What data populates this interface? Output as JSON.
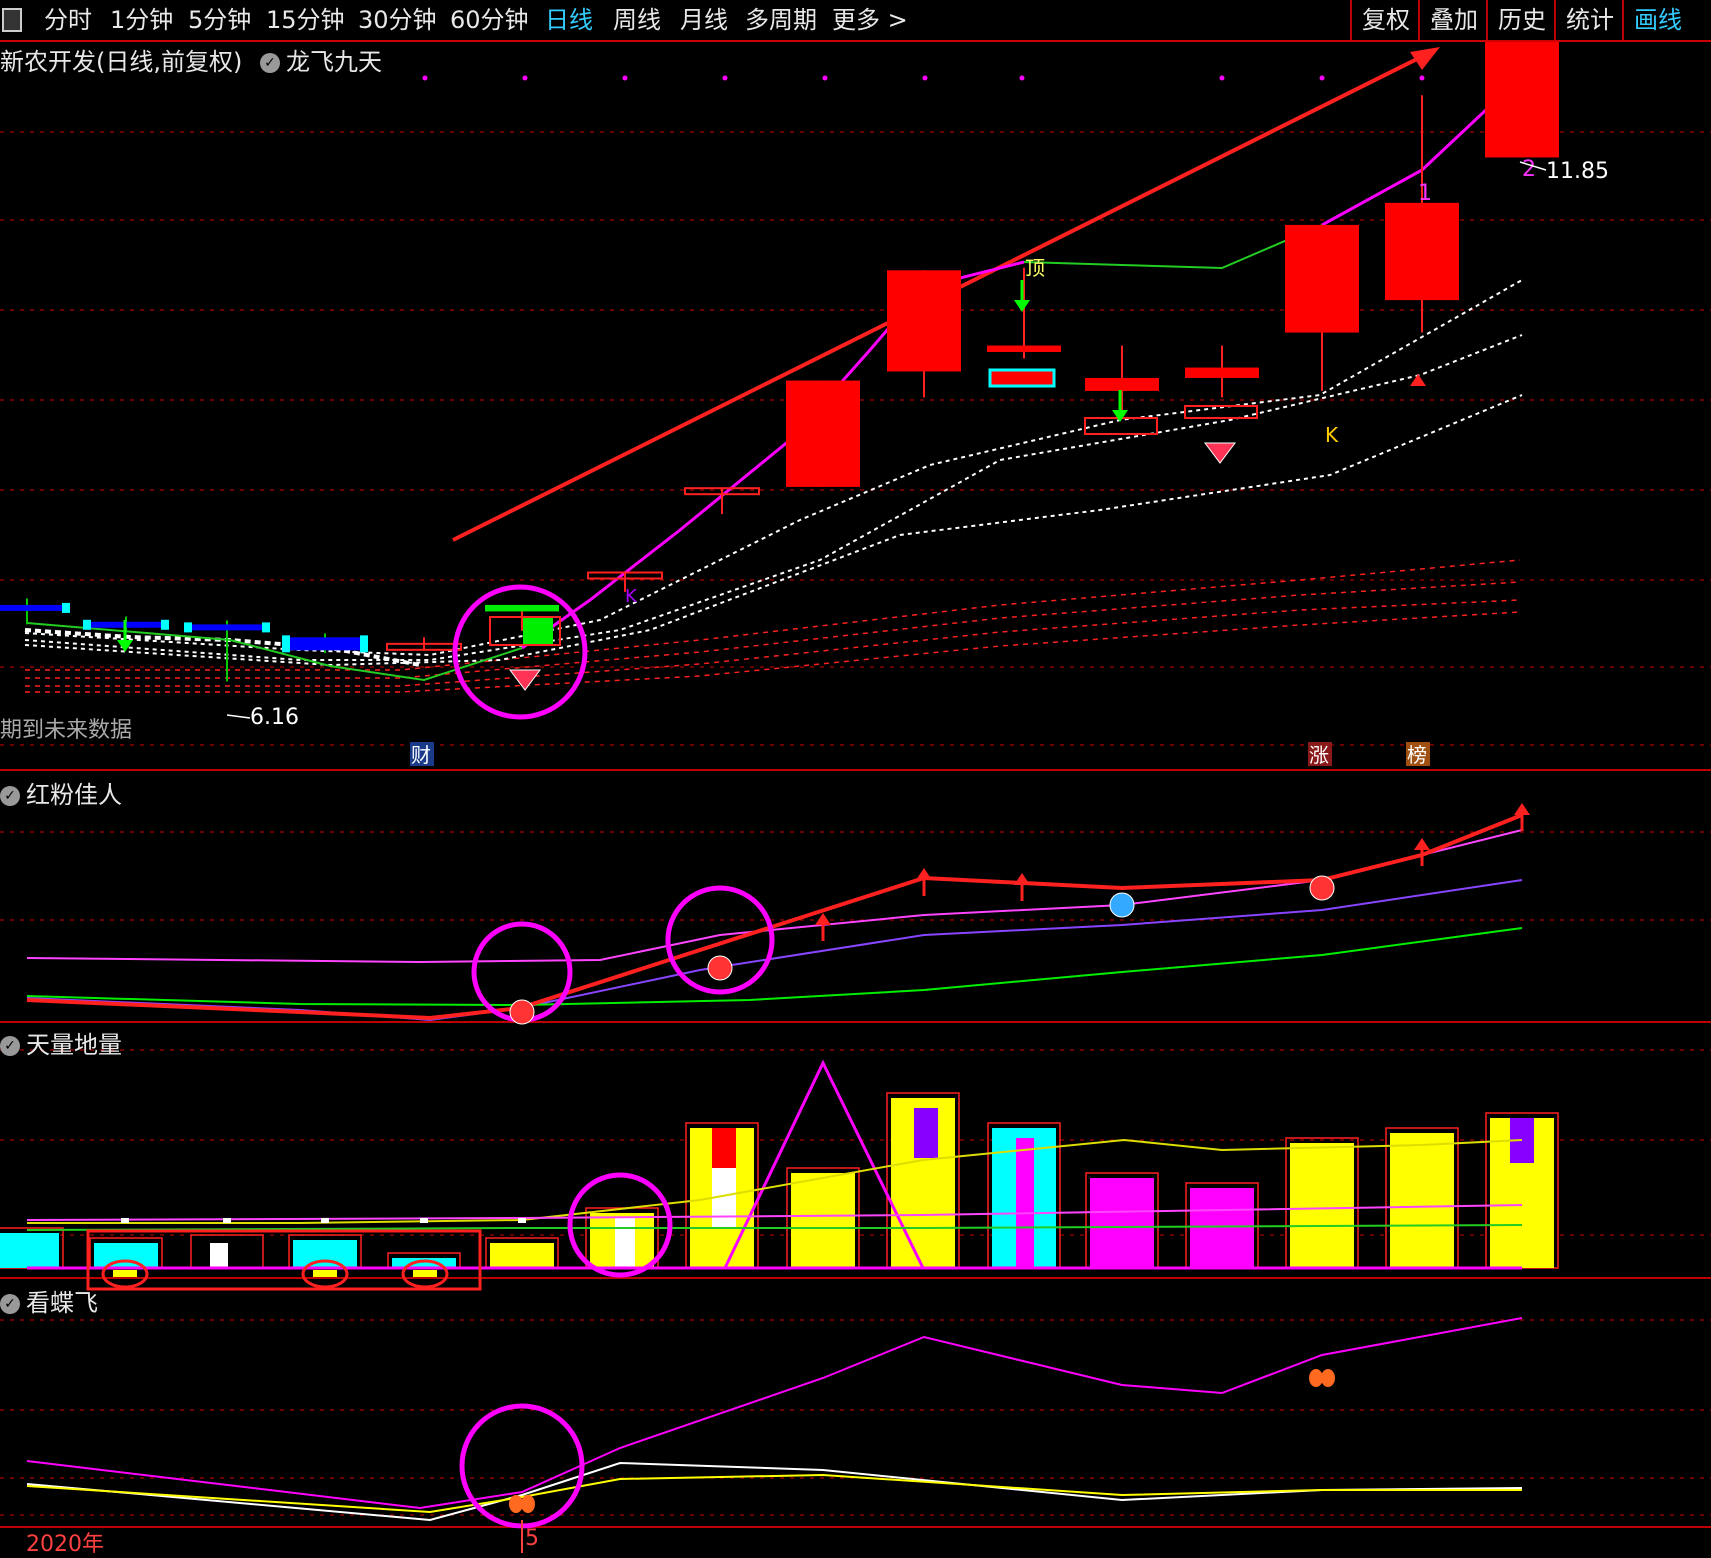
{
  "toolbar": {
    "tabs": [
      {
        "label": "分时",
        "active": false
      },
      {
        "label": "1分钟",
        "active": false
      },
      {
        "label": "5分钟",
        "active": false
      },
      {
        "label": "15分钟",
        "active": false
      },
      {
        "label": "30分钟",
        "active": false
      },
      {
        "label": "60分钟",
        "active": false
      },
      {
        "label": "日线",
        "active": true
      },
      {
        "label": "周线",
        "active": false
      },
      {
        "label": "月线",
        "active": false
      },
      {
        "label": "多周期",
        "active": false
      },
      {
        "label": "更多 >",
        "active": false
      }
    ],
    "right": [
      {
        "label": "复权",
        "active": false
      },
      {
        "label": "叠加",
        "active": false
      },
      {
        "label": "历史",
        "active": false
      },
      {
        "label": "统计",
        "active": false
      },
      {
        "label": "画线",
        "active": true
      }
    ]
  },
  "main": {
    "title": "新农开发(日线,前复权)",
    "indicator": "龙飞九天",
    "high_label": "11.85",
    "low_label": "6.16",
    "future_note": "期到未来数据",
    "wave_labels": [
      "1",
      "2"
    ],
    "k_marks": [
      "K",
      "K"
    ],
    "dd_mark": "顶",
    "event_tags": [
      {
        "text": "财",
        "color": "#1a3a8a"
      },
      {
        "text": "涨",
        "color": "#8a1a1a"
      },
      {
        "text": "榜",
        "color": "#a05010"
      }
    ]
  },
  "panel2": {
    "title": "红粉佳人"
  },
  "panel3": {
    "title": "天量地量"
  },
  "panel4": {
    "title": "看蝶飞"
  },
  "xaxis": {
    "year": "2020年",
    "month": "5"
  },
  "colors": {
    "up": "#ff0000",
    "down_hist": "#0000ff",
    "grid": "#8a0000",
    "magenta": "#ff00ff",
    "accent": "#33ccff"
  },
  "chart_data": {
    "type": "candlestick",
    "title": "新农开发(日线,前复权)",
    "price_range": [
      5.5,
      12.0
    ],
    "annotated_high": 11.85,
    "annotated_low": 6.16,
    "candles": [
      {
        "open": 6.75,
        "high": 6.8,
        "low": 6.6,
        "close": 6.72,
        "color": "blue"
      },
      {
        "open": 6.62,
        "high": 6.66,
        "low": 6.55,
        "close": 6.6,
        "color": "blue"
      },
      {
        "open": 6.6,
        "high": 6.63,
        "low": 6.16,
        "close": 6.56,
        "color": "blue"
      },
      {
        "open": 6.5,
        "high": 6.53,
        "low": 6.38,
        "close": 6.4,
        "color": "blue"
      },
      {
        "open": 6.45,
        "high": 6.5,
        "low": 6.4,
        "close": 6.45,
        "color": "doji"
      },
      {
        "open": 6.7,
        "high": 6.75,
        "low": 6.55,
        "close": 6.75,
        "color": "green"
      },
      {
        "open": 7.0,
        "high": 7.0,
        "low": 6.85,
        "close": 7.0,
        "color": "doji"
      },
      {
        "open": 7.65,
        "high": 7.65,
        "low": 7.45,
        "close": 7.65,
        "color": "doji"
      },
      {
        "open": 7.66,
        "high": 8.48,
        "low": 7.66,
        "close": 8.48,
        "color": "red"
      },
      {
        "open": 8.55,
        "high": 9.33,
        "low": 8.35,
        "close": 9.33,
        "color": "red"
      },
      {
        "open": 8.75,
        "high": 9.35,
        "low": 8.65,
        "close": 8.7,
        "color": "red"
      },
      {
        "open": 8.4,
        "high": 8.75,
        "low": 8.25,
        "close": 8.5,
        "color": "red"
      },
      {
        "open": 8.5,
        "high": 8.75,
        "low": 8.35,
        "close": 8.58,
        "color": "red"
      },
      {
        "open": 8.85,
        "high": 8.95,
        "low": 8.4,
        "close": 9.68,
        "color": "red"
      },
      {
        "open": 9.1,
        "high": 10.68,
        "low": 8.85,
        "close": 9.85,
        "color": "red"
      },
      {
        "open": 10.2,
        "high": 11.85,
        "low": 10.2,
        "close": 11.85,
        "color": "red"
      }
    ],
    "panels": [
      "红粉佳人",
      "天量地量",
      "看蝶飞"
    ]
  }
}
